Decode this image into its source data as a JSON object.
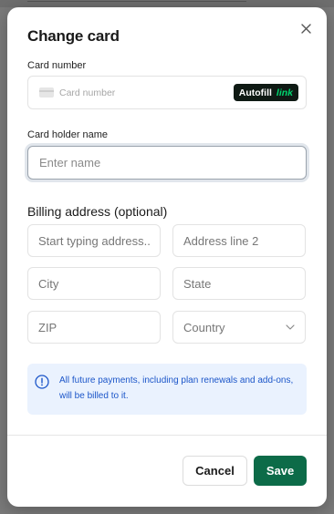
{
  "modal": {
    "title": "Change card",
    "close_icon": "close-icon"
  },
  "card_number": {
    "label": "Card number",
    "placeholder": "Card number",
    "icon": "credit-card-icon",
    "autofill_label": "Autofill",
    "autofill_brand": "link"
  },
  "card_holder": {
    "label": "Card holder name",
    "placeholder": "Enter name",
    "value": ""
  },
  "billing": {
    "section_title": "Billing address (optional)",
    "street_placeholder": "Start typing address...",
    "line2_placeholder": "Address line 2",
    "city_placeholder": "City",
    "state_placeholder": "State",
    "zip_placeholder": "ZIP",
    "country_value": "Country",
    "country_icon": "chevron-down-icon"
  },
  "notice": {
    "icon": "info-icon",
    "text": "All future payments, including plan renewals and add-ons, will be billed to it."
  },
  "footer": {
    "cancel_label": "Cancel",
    "save_label": "Save"
  },
  "colors": {
    "primary": "#0c6b48",
    "notice_bg": "#eaf2fe",
    "notice_text": "#1c56c9",
    "link_brand": "#00d66f"
  }
}
